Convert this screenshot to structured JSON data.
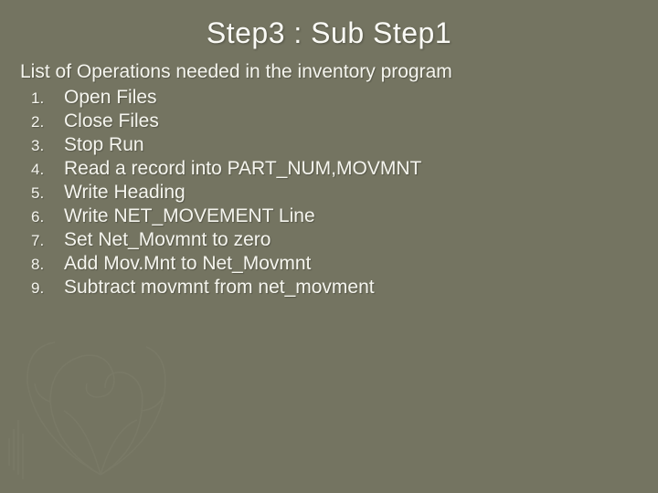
{
  "title": "Step3 : Sub Step1",
  "subtitle": "List of Operations needed in the inventory program",
  "items": [
    {
      "marker": "1.",
      "text": "Open Files"
    },
    {
      "marker": "2.",
      "text": "Close Files"
    },
    {
      "marker": "3.",
      "text": "Stop Run"
    },
    {
      "marker": "4.",
      "text": "Read a record into PART_NUM,MOVMNT"
    },
    {
      "marker": "5.",
      "text": "Write Heading"
    },
    {
      "marker": "6.",
      "text": "Write NET_MOVEMENT Line"
    },
    {
      "marker": "7.",
      "text": "Set Net_Movmnt to zero"
    },
    {
      "marker": "8.",
      "text": "Add Mov.Mnt to Net_Movmnt"
    },
    {
      "marker": "9.",
      "text": "Subtract movmnt from net_movment"
    }
  ]
}
